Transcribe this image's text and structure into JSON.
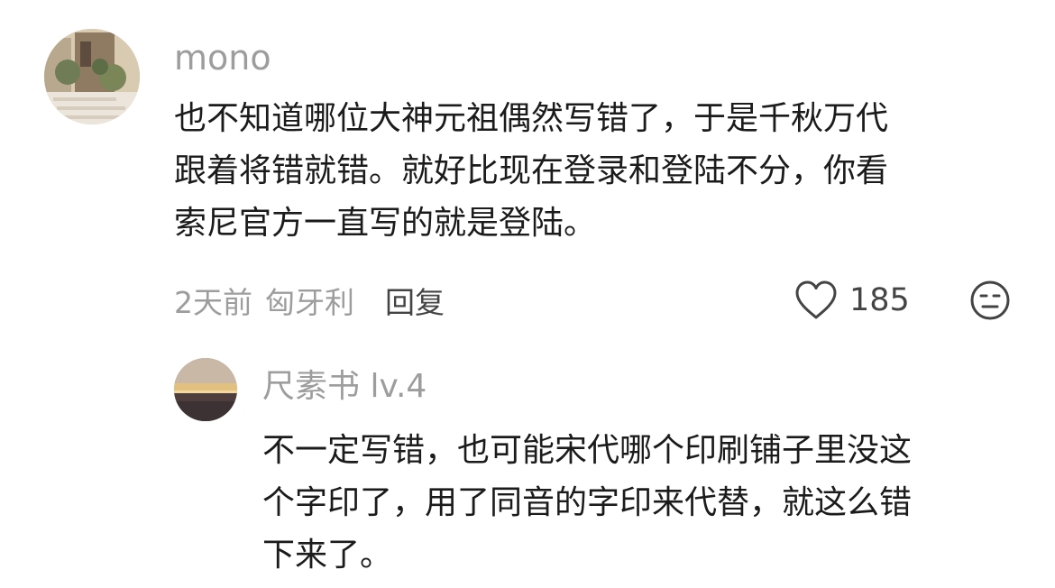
{
  "comment": {
    "username": "mono",
    "avatar_icon": "avatar-photo-icon",
    "text_lines": [
      "也不知道哪位大神元祖偶然写错了，于是千秋万代",
      "跟着将错就错。就好比现在登录和登陆不分，你看",
      "索尼官方一直写的就是登陆。"
    ],
    "time": "2天前",
    "location": "匈牙利",
    "reply_label": "回复",
    "like_icon": "heart-outline-icon",
    "like_count": "185",
    "dislike_icon": "neutral-face-icon"
  },
  "reply": {
    "username": "尺素书 lv.4",
    "avatar_icon": "avatar-sunset-icon",
    "text_lines": [
      "不一定写错，也可能宋代哪个印刷铺子里没这",
      "个字印了，用了同音的字印来代替，就这么错",
      "下来了。"
    ]
  },
  "colors": {
    "text_primary": "#1b1b1b",
    "text_secondary": "#9d9d9d",
    "icon": "#444444"
  }
}
